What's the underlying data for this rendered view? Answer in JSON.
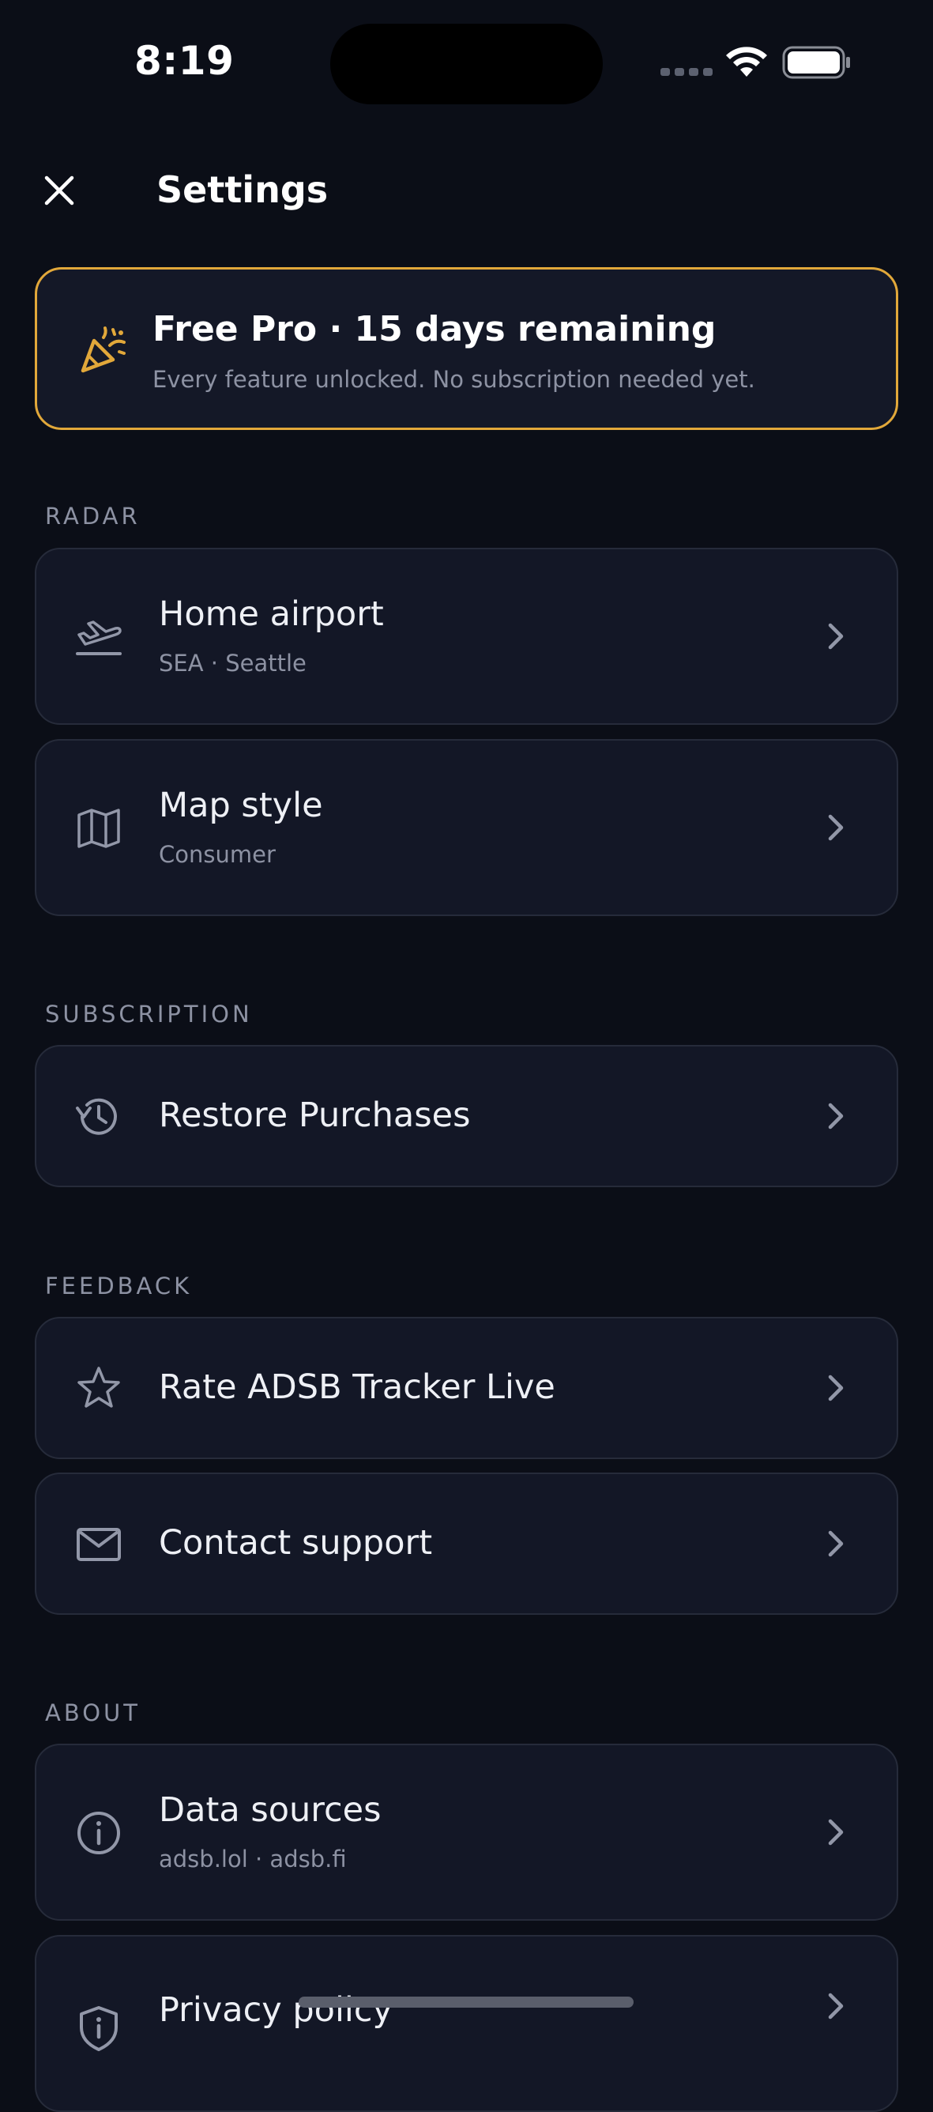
{
  "status_bar": {
    "time": "8:19"
  },
  "header": {
    "title": "Settings"
  },
  "promo": {
    "title": "Free Pro · 15 days remaining",
    "subtitle": "Every feature unlocked. No subscription needed yet.",
    "icon": "party-popper-icon",
    "accent_color": "#e2a83a"
  },
  "sections": {
    "radar": {
      "label": "RADAR",
      "items": [
        {
          "title": "Home airport",
          "subtitle": "SEA · Seattle",
          "icon": "plane-departure-icon"
        },
        {
          "title": "Map style",
          "subtitle": "Consumer",
          "icon": "map-icon"
        }
      ]
    },
    "subscription": {
      "label": "SUBSCRIPTION",
      "items": [
        {
          "title": "Restore Purchases",
          "icon": "history-icon"
        }
      ]
    },
    "feedback": {
      "label": "FEEDBACK",
      "items": [
        {
          "title": "Rate ADSB Tracker Live",
          "icon": "star-icon"
        },
        {
          "title": "Contact support",
          "icon": "mail-icon"
        }
      ]
    },
    "about": {
      "label": "ABOUT",
      "items": [
        {
          "title": "Data sources",
          "subtitle": "adsb.lol · adsb.fi",
          "icon": "info-icon"
        },
        {
          "title": "Privacy policy",
          "icon": "shield-icon"
        }
      ]
    }
  },
  "colors": {
    "background": "#0b0e17",
    "card": "#131726",
    "card_border": "#262b3a",
    "muted_text": "#8d92a3"
  }
}
